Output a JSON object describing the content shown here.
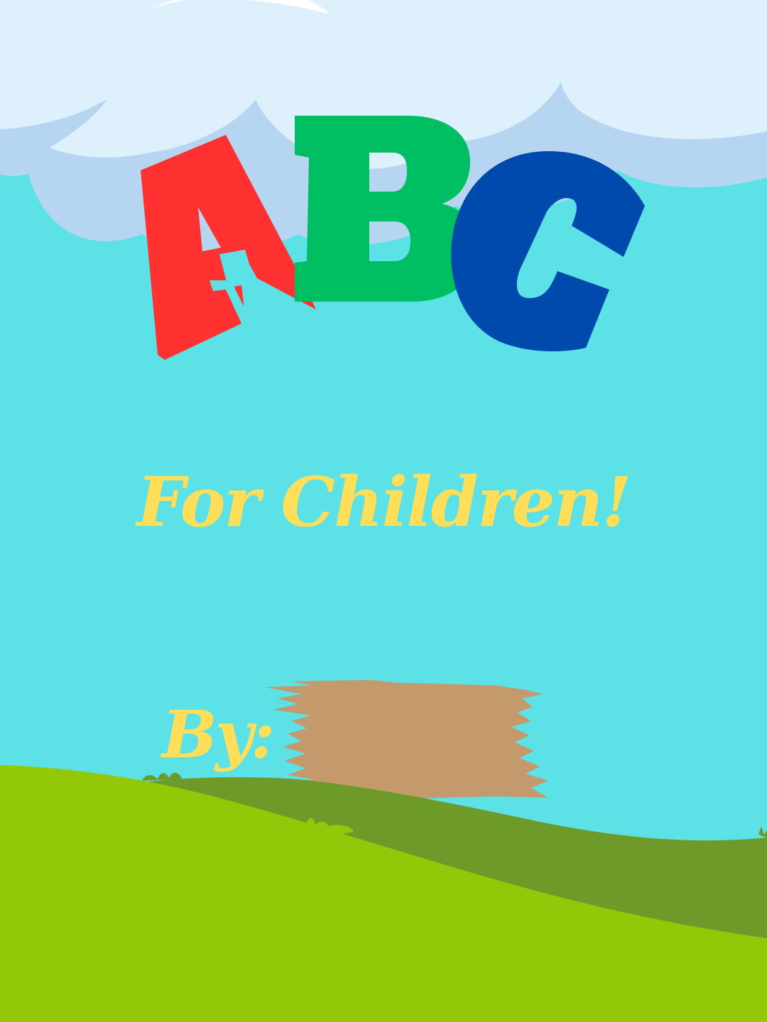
{
  "cover": {
    "title_letters": [
      "A",
      "B",
      "C"
    ],
    "subtitle": "For Children!",
    "byline_label": "By:"
  },
  "colors": {
    "sky": "#5ce1e6",
    "cloud_light": "#dff0fd",
    "cloud_shadow": "#b6d5f0",
    "letter_a": "#ff3131",
    "letter_b": "#00bf63",
    "letter_c": "#004aad",
    "text_yellow": "#ffde59",
    "hill_dark": "#6d9a28",
    "hill_light": "#92c808",
    "redaction": "#c4996c"
  },
  "icons": {
    "cloud": "cloud-icon",
    "hill": "grass-hill",
    "redaction": "brush-stroke"
  }
}
